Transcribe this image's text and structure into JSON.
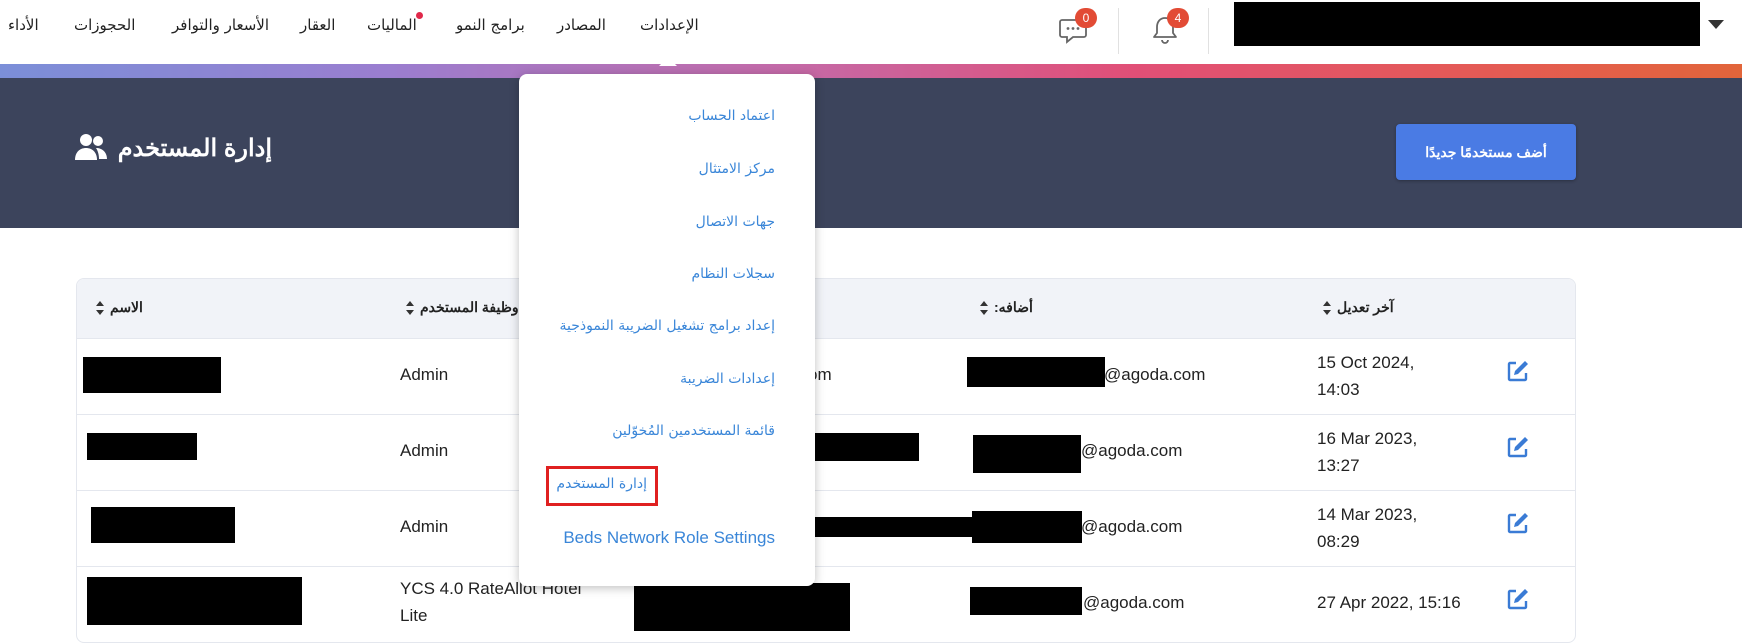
{
  "nav": {
    "items": [
      {
        "label": "الأداء"
      },
      {
        "label": "الحجوزات"
      },
      {
        "label": "الأسعار والتوافر"
      },
      {
        "label": "العقار"
      },
      {
        "label": "الماليات"
      },
      {
        "label": "برامج النمو"
      },
      {
        "label": "المصادر"
      },
      {
        "label": "الإعدادات"
      }
    ],
    "messages_badge": "0",
    "notifications_badge": "4"
  },
  "header": {
    "title": "إدارة المستخدم",
    "add_button": "أضف مستخدمًا جديدًا"
  },
  "table": {
    "columns": [
      {
        "label": "الاسم"
      },
      {
        "label": "وظيفة المستخدم"
      },
      {
        "label": ":أضافه"
      },
      {
        "label": "آخر تعديل"
      }
    ],
    "rows": [
      {
        "role": "Admin",
        "partial_text": "om",
        "added_by_suffix": "@agoda.com",
        "modified_line1": "15 Oct 2024,",
        "modified_line2": "14:03"
      },
      {
        "role": "Admin",
        "partial_text": "",
        "added_by_suffix": "@agoda.com",
        "modified_line1": "16 Mar 2023,",
        "modified_line2": "13:27"
      },
      {
        "role": "Admin",
        "partial_text": "",
        "added_by_suffix": "@agoda.com",
        "modified_line1": "14 Mar 2023,",
        "modified_line2": "08:29"
      },
      {
        "role": "YCS 4.0 RateAllot Hotel Lite",
        "partial_text": "",
        "added_by_suffix": "@agoda.com",
        "modified_line1": "27 Apr 2022, 15:16",
        "modified_line2": ""
      }
    ]
  },
  "dropdown": {
    "items": [
      {
        "label": "اعتماد الحساب"
      },
      {
        "label": "مركز الامتثال"
      },
      {
        "label": "جهات الاتصال"
      },
      {
        "label": "سجلات النظام"
      },
      {
        "label": "إعداد برامج تشغيل الضريبة النموذجية"
      },
      {
        "label": "إعدادات الضريبة"
      },
      {
        "label": "قائمة المستخدمين المُخوّلين"
      },
      {
        "label": "إدارة المستخدم"
      },
      {
        "label": "Beds Network Role Settings"
      }
    ]
  },
  "colors": {
    "header_bg": "#3c445c",
    "primary_button": "#4a7be4",
    "link": "#3a86d8",
    "badge": "#e24b35",
    "highlight": "#e02020"
  }
}
